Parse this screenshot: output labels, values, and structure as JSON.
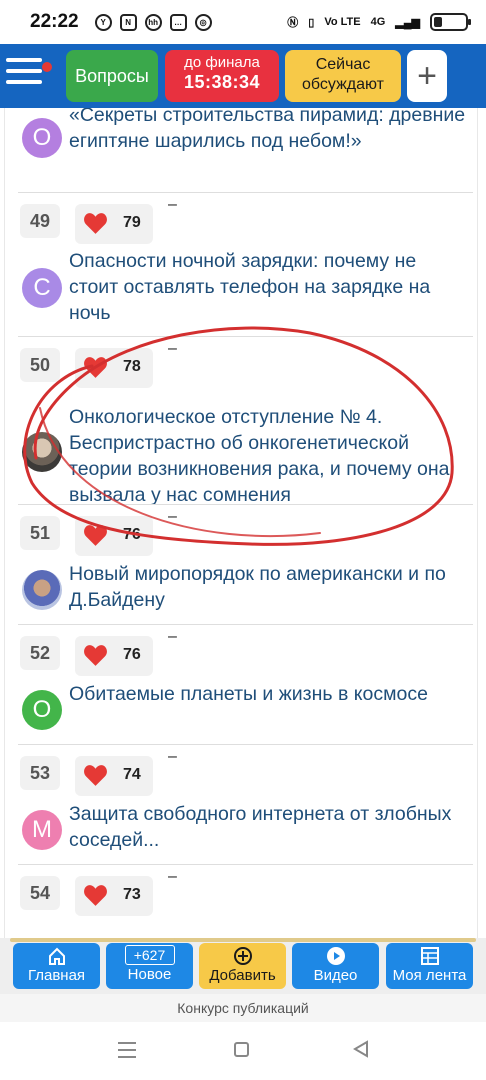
{
  "status_bar": {
    "time": "22:22",
    "network_label": "4G",
    "volte_label": "Vo LTE"
  },
  "header": {
    "questions_label": "Вопросы",
    "final_label": "до финала",
    "countdown": "15:38:34",
    "discuss_line1": "Сейчас",
    "discuss_line2": "обсуждают",
    "plus_label": "+"
  },
  "items": [
    {
      "rank": "",
      "likes": "",
      "dash": "",
      "avatar_letter": "О",
      "avatar_color": "#b47fe0",
      "title": "«Секреты строительства пирамид: древние египтяне шарились под небом!»"
    },
    {
      "rank": "49",
      "likes": "79",
      "dash": "–",
      "avatar_letter": "С",
      "avatar_color": "#a98ae6",
      "title": "Опасности ночной зарядки: почему не стоит оставлять телефон на зарядке на ночь"
    },
    {
      "rank": "50",
      "likes": "78",
      "dash": "–",
      "avatar_letter": "",
      "avatar_color": "#6c6157",
      "title": "Онкологическое отступление № 4. Беспристрастно об онкогенетической теории возникновения рака, и почему она вызвала у нас сомнения"
    },
    {
      "rank": "51",
      "likes": "76",
      "dash": "–",
      "avatar_letter": "",
      "avatar_color": "#5a6bb8",
      "title": "Новый миропорядок по американски и по Д.Байдену"
    },
    {
      "rank": "52",
      "likes": "76",
      "dash": "–",
      "avatar_letter": "О",
      "avatar_color": "#43b54a",
      "title": "Обитаемые планеты и жизнь в космосе"
    },
    {
      "rank": "53",
      "likes": "74",
      "dash": "–",
      "avatar_letter": "М",
      "avatar_color": "#ee7fb0",
      "title": "Защита свободного интернета от злобных соседей..."
    },
    {
      "rank": "54",
      "likes": "73",
      "dash": "–",
      "avatar_letter": "",
      "avatar_color": "#a98ae6",
      "title": ""
    }
  ],
  "bottom_nav": {
    "home_label": "Главная",
    "new_count": "+627",
    "new_label": "Новое",
    "add_label": "Добавить",
    "video_label": "Видео",
    "feed_label": "Моя лента"
  },
  "contest_label": "Конкурс публикаций",
  "colors": {
    "brand_blue": "#1565c0",
    "heart_red": "#e53935",
    "link_blue": "#1f4e79",
    "annotation_red": "#d32f2f"
  }
}
